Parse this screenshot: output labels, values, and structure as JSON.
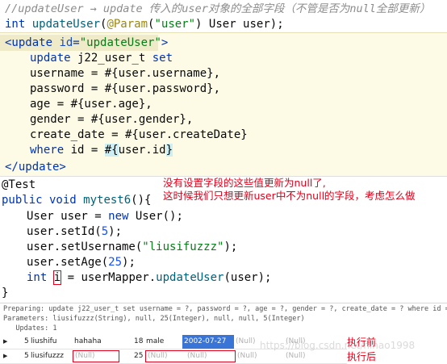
{
  "java_top": {
    "comment": "//updateUser → update 传入的user对象的全部字段（不管是否为null全部更新）",
    "sig_int": "int ",
    "sig_name": "updateUser",
    "sig_paren_open": "(",
    "sig_annotation": "@Param",
    "sig_ann_open": "(",
    "sig_string": "\"user\"",
    "sig_rest": ") User user);"
  },
  "xml": {
    "line1_open": "<update ",
    "line1_attr": "id",
    "line1_eq": "=",
    "line1_value": "\"updateUser\"",
    "line1_close": ">",
    "line2_kw": "update",
    "line2_rest": " j22_user_t ",
    "line2_kw2": "set",
    "line3": "username = #{user.username},",
    "line4": "password = #{user.password},",
    "line5": "age = #{user.age},",
    "line6": "gender = #{user.gender},",
    "line7": "create_date = #{user.createDate}",
    "line8_kw": "where",
    "line8_mid": " id = ",
    "line8_hl": "#{",
    "line8_mid2": "user.id",
    "line8_hl2": "}",
    "line9": "</update>"
  },
  "test": {
    "annotation": "@Test",
    "sig_kw": "public void ",
    "sig_name": "mytest6",
    "sig_rest": "(){",
    "line_newuser_a": "User user = ",
    "line_newuser_kw": "new",
    "line_newuser_b": " User();",
    "line_setid_a": "user.setId(",
    "line_setid_num": "5",
    "line_setid_b": ");",
    "line_setname_a": "user.setUsername(",
    "line_setname_str": "\"liusifuzzz\"",
    "line_setname_b": ");",
    "line_setage_a": "user.setAge(",
    "line_setage_num": "25",
    "line_setage_b": ");",
    "line_int_kw": "int ",
    "line_int_var": "i",
    "line_int_b": " = userMapper.",
    "line_int_fn": "updateUser",
    "line_int_c": "(user);",
    "close": "}",
    "note_line1": "没有设置字段的这些值更新为null了,",
    "note_line2": "这时候我们只想更新user中不为null的字段，考虑怎么做"
  },
  "log": {
    "preparing": "Preparing: update j22_user_t set username = ?, password = ?, age = ?, gender = ?, create_date = ? where id = ?",
    "parameters": "Parameters: liusifuzzz(String), null, 25(Integer), null, null, 5(Integer)",
    "updates": "   Updates: 1"
  },
  "grid": {
    "rows": [
      {
        "id": "5",
        "username": "liushifu",
        "password": "hahaha",
        "age": "18",
        "gender": "male",
        "create_date": "2002-07-27",
        "c7": "(Null)",
        "c8": "(Null)",
        "label": "执行前"
      },
      {
        "id": "5",
        "username": "liusifuzzz",
        "password": "(Null)",
        "age": "25",
        "gender": "(Null)",
        "create_date": "(Null)",
        "c7": "(Null)",
        "c8": "(Null)",
        "label": "执行后"
      }
    ],
    "watermark": "https://blog.csdn.net/nihao1998"
  },
  "colors": {
    "keyword": "#0033b3",
    "string": "#067d17",
    "annotation": "#9e880d",
    "note_red": "#e0001a",
    "xml_bg": "#fdfbe6",
    "selected_cell": "#3875d7"
  }
}
